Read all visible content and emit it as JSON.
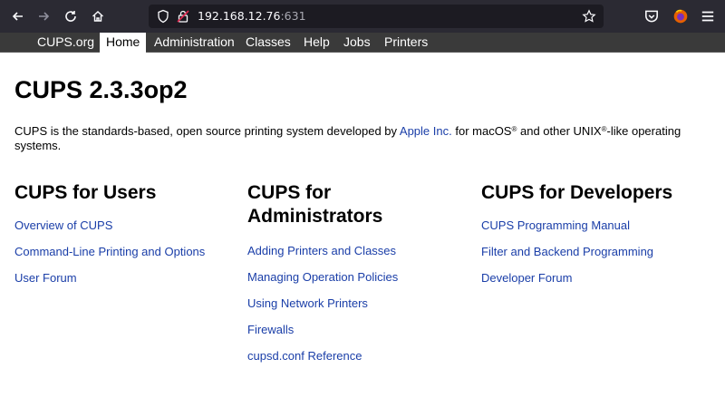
{
  "browser": {
    "url_host": "192.168.12.76",
    "url_port": ":631",
    "icons": [
      "back-arrow-icon",
      "forward-arrow-icon",
      "reload-icon",
      "home-icon",
      "shield-icon",
      "insecure-lock-icon",
      "bookmark-star-icon",
      "pocket-icon",
      "firefox-account-icon",
      "hamburger-menu-icon"
    ],
    "colors": {
      "toolbar": "#2b2a33",
      "urlbar": "#1c1b22"
    }
  },
  "nav": {
    "tabs": [
      "CUPS.org",
      "Home",
      "Administration",
      "Classes",
      "Help",
      "Jobs",
      "Printers"
    ],
    "active": "Home"
  },
  "page": {
    "title": "CUPS 2.3.3op2",
    "intro_before": "CUPS is the standards-based, open source printing system developed by ",
    "intro_link": "Apple Inc.",
    "intro_mid": " for macOS",
    "reg": "®",
    "intro_and": " and other UNIX",
    "intro_after": "-like operating systems."
  },
  "columns": {
    "users": {
      "heading": "CUPS for Users",
      "links": [
        "Overview of CUPS",
        "Command-Line Printing and Options",
        "User Forum"
      ]
    },
    "admins": {
      "heading_line1": "CUPS for",
      "heading_line2": "Administrators",
      "links": [
        "Adding Printers and Classes",
        "Managing Operation Policies",
        "Using Network Printers",
        "Firewalls",
        "cupsd.conf Reference"
      ]
    },
    "devs": {
      "heading": "CUPS for Developers",
      "links": [
        "CUPS Programming Manual",
        "Filter and Backend Programming",
        "Developer Forum"
      ]
    }
  },
  "colors": {
    "link": "#1a3ea8",
    "nav_bg": "#3a3a3a"
  }
}
